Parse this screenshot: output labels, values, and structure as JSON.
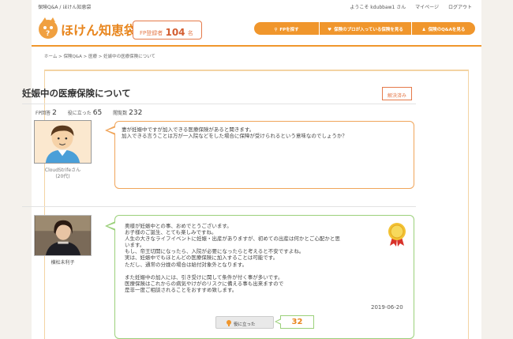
{
  "header": {
    "top_left": "保険Q&A / ほけん知恵袋",
    "welcome": "ようこそ kdubbaw1 さん",
    "mypage": "マイページ",
    "logout": "ログアウト",
    "logo_text": "ほけん知恵袋",
    "fp_count_label": "FP登録者",
    "fp_count_value": "104",
    "fp_count_unit": "名",
    "nav": [
      {
        "label": "FPを探す",
        "icon": "search-icon"
      },
      {
        "label": "保険のプロが入っている保険を見る",
        "icon": "heart-icon"
      },
      {
        "label": "保険のQ&Aを見る",
        "icon": "person-icon"
      }
    ]
  },
  "breadcrumb": [
    "ホーム",
    "保険Q&A",
    "医療",
    "妊娠中の医療保険について"
  ],
  "question": {
    "title": "妊娠中の医療保険について",
    "status": "解決済み",
    "stats": {
      "fp_answers_label": "FP回答",
      "fp_answers": "2",
      "useful_label": "役に立った",
      "useful": "65",
      "views_label": "閲覧数",
      "views": "232"
    },
    "user_name": "CloudStrifeさん",
    "user_age": "(20代)",
    "text_lines": [
      "妻が妊娠中ですが加入できる医療保険があると聞きます。",
      "加入できる言うことは万が一入院などをした場合に保障が受けられるという意味なのでしょうか？"
    ]
  },
  "answer": {
    "author": "横松未利子",
    "text_lines": [
      "奥様が妊娠中との事、おめでとうございます。",
      "お子様のご誕生、とても楽しみですね。",
      "人生の大きなライフイベントに妊娠・出産がありますが、初めての出産は何かとご心配かと思",
      "います。",
      "もし、帝王切開になったら、入院が必要になったらと考えると不安ですよね。",
      "実は、妊娠中でもほとんどの医療保険に加入することは可能です。",
      "ただし、通常の分娩の場合は給付対象外となります。",
      "",
      "また妊娠中の加入には、引き受けに関して条件が付く事が多いです。",
      "医療保険はこれからの病気やけがのリスクに備える事も出来ますので",
      "是非一度ご相談されることをおすすめ致します。"
    ],
    "date": "2019-06-20",
    "useful_button": "役に立った",
    "useful_count": "32"
  },
  "colors": {
    "accent": "#f0962c",
    "question_border": "#f0a55a",
    "answer_border": "#9bd07a",
    "status": "#e57a4a"
  }
}
